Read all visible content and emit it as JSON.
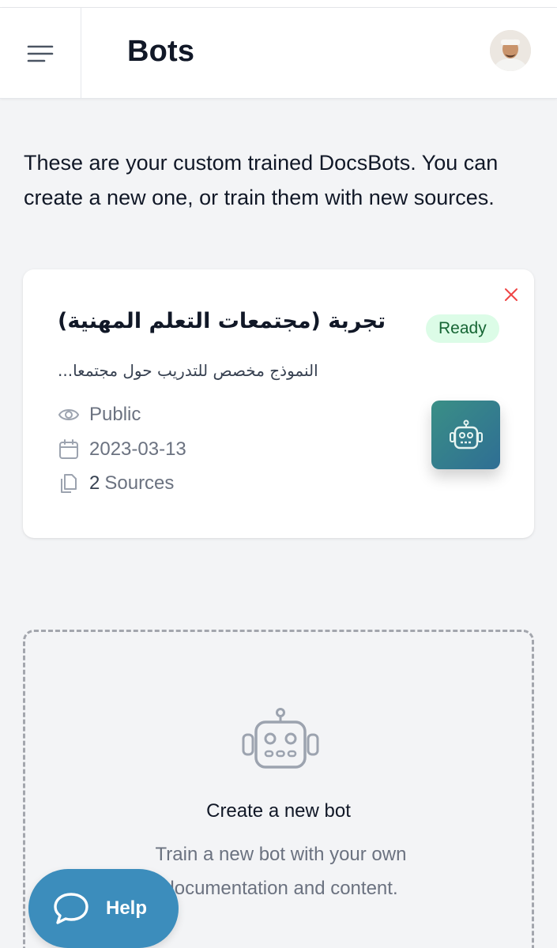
{
  "header": {
    "title": "Bots",
    "menu_icon": "hamburger-menu-icon",
    "avatar": "user-avatar"
  },
  "intro": {
    "text": "These are your custom trained DocsBots. You can create a new one, or train them with new sources."
  },
  "bots": [
    {
      "name": "تجربة (مجتمعات التعلم المهنية)",
      "status": "Ready",
      "description": "النموذج مخصص للتدريب حول مجتمعا...",
      "visibility": "Public",
      "date": "2023-03-13",
      "sources_count": "2",
      "sources_label": "Sources",
      "icons": {
        "close": "close-icon",
        "visibility": "eye-icon",
        "date": "calendar-icon",
        "sources": "documents-icon",
        "tile": "robot-icon"
      }
    }
  ],
  "create": {
    "title": "Create a new bot",
    "subtitle": "Train a new bot with your own documentation and content.",
    "icon": "robot-icon"
  },
  "help": {
    "label": "Help",
    "icon": "chat-bubble-icon"
  },
  "colors": {
    "ready_badge_bg": "#dcfce7",
    "ready_badge_text": "#166534",
    "help_button": "#3c8dbc",
    "bot_tile_start": "#3a8f86",
    "bot_tile_end": "#2f6e94"
  }
}
